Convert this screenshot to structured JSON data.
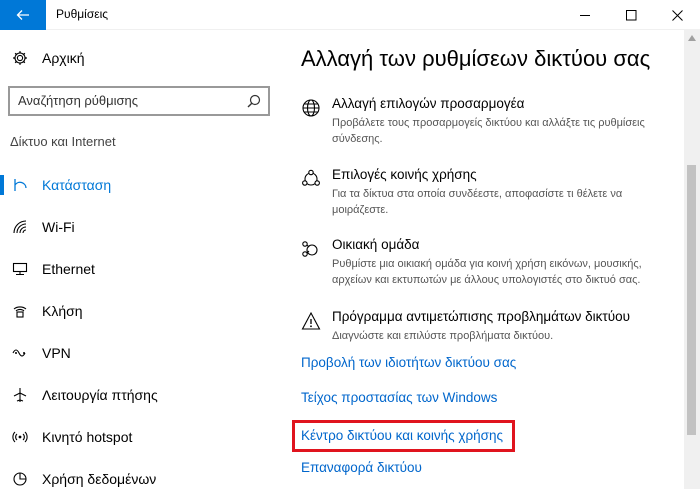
{
  "window": {
    "title": "Ρυθμίσεις"
  },
  "sidebar": {
    "home_label": "Αρχική",
    "search_placeholder": "Αναζήτηση ρύθμισης",
    "section_title": "Δίκτυο και Internet",
    "items": [
      {
        "label": "Κατάσταση",
        "icon": "status-icon",
        "active": true
      },
      {
        "label": "Wi-Fi",
        "icon": "wifi-icon"
      },
      {
        "label": "Ethernet",
        "icon": "ethernet-icon"
      },
      {
        "label": "Κλήση",
        "icon": "dialup-icon"
      },
      {
        "label": "VPN",
        "icon": "vpn-icon"
      },
      {
        "label": "Λειτουργία πτήσης",
        "icon": "airplane-icon"
      },
      {
        "label": "Κινητό hotspot",
        "icon": "hotspot-icon"
      },
      {
        "label": "Χρήση δεδομένων",
        "icon": "data-usage-icon"
      }
    ]
  },
  "main": {
    "title": "Αλλαγή των ρυθμίσεων δικτύου σας",
    "options": [
      {
        "title": "Αλλαγή επιλογών προσαρμογέα",
        "desc": "Προβάλετε τους προσαρμογείς δικτύου και αλλάξτε τις ρυθμίσεις σύνδεσης.",
        "icon": "adapter-globe-icon"
      },
      {
        "title": "Επιλογές κοινής χρήσης",
        "desc": "Για τα δίκτυα στα οποία συνδέεστε, αποφασίστε τι θέλετε να μοιράζεστε.",
        "icon": "sharing-icon"
      },
      {
        "title": "Οικιακή ομάδα",
        "desc": "Ρυθμίστε μια οικιακή ομάδα για κοινή χρήση εικόνων, μουσικής, αρχείων και εκτυπωτών με άλλους υπολογιστές στο δικτυό σας.",
        "icon": "homegroup-icon"
      },
      {
        "title": "Πρόγραμμα αντιμετώπισης προβλημάτων δικτύου",
        "desc": "Διαγνώστε και επιλύστε προβλήματα δικτύου.",
        "icon": "warning-icon"
      }
    ],
    "links": [
      "Προβολή των ιδιοτήτων δικτύου σας",
      "Τείχος προστασίας των Windows",
      "Κέντρο δικτύου και κοινής χρήσης",
      "Επαναφορά δικτύου"
    ]
  },
  "colors": {
    "accent": "#0078d7",
    "link": "#0066cc",
    "highlight": "#e0141e"
  }
}
